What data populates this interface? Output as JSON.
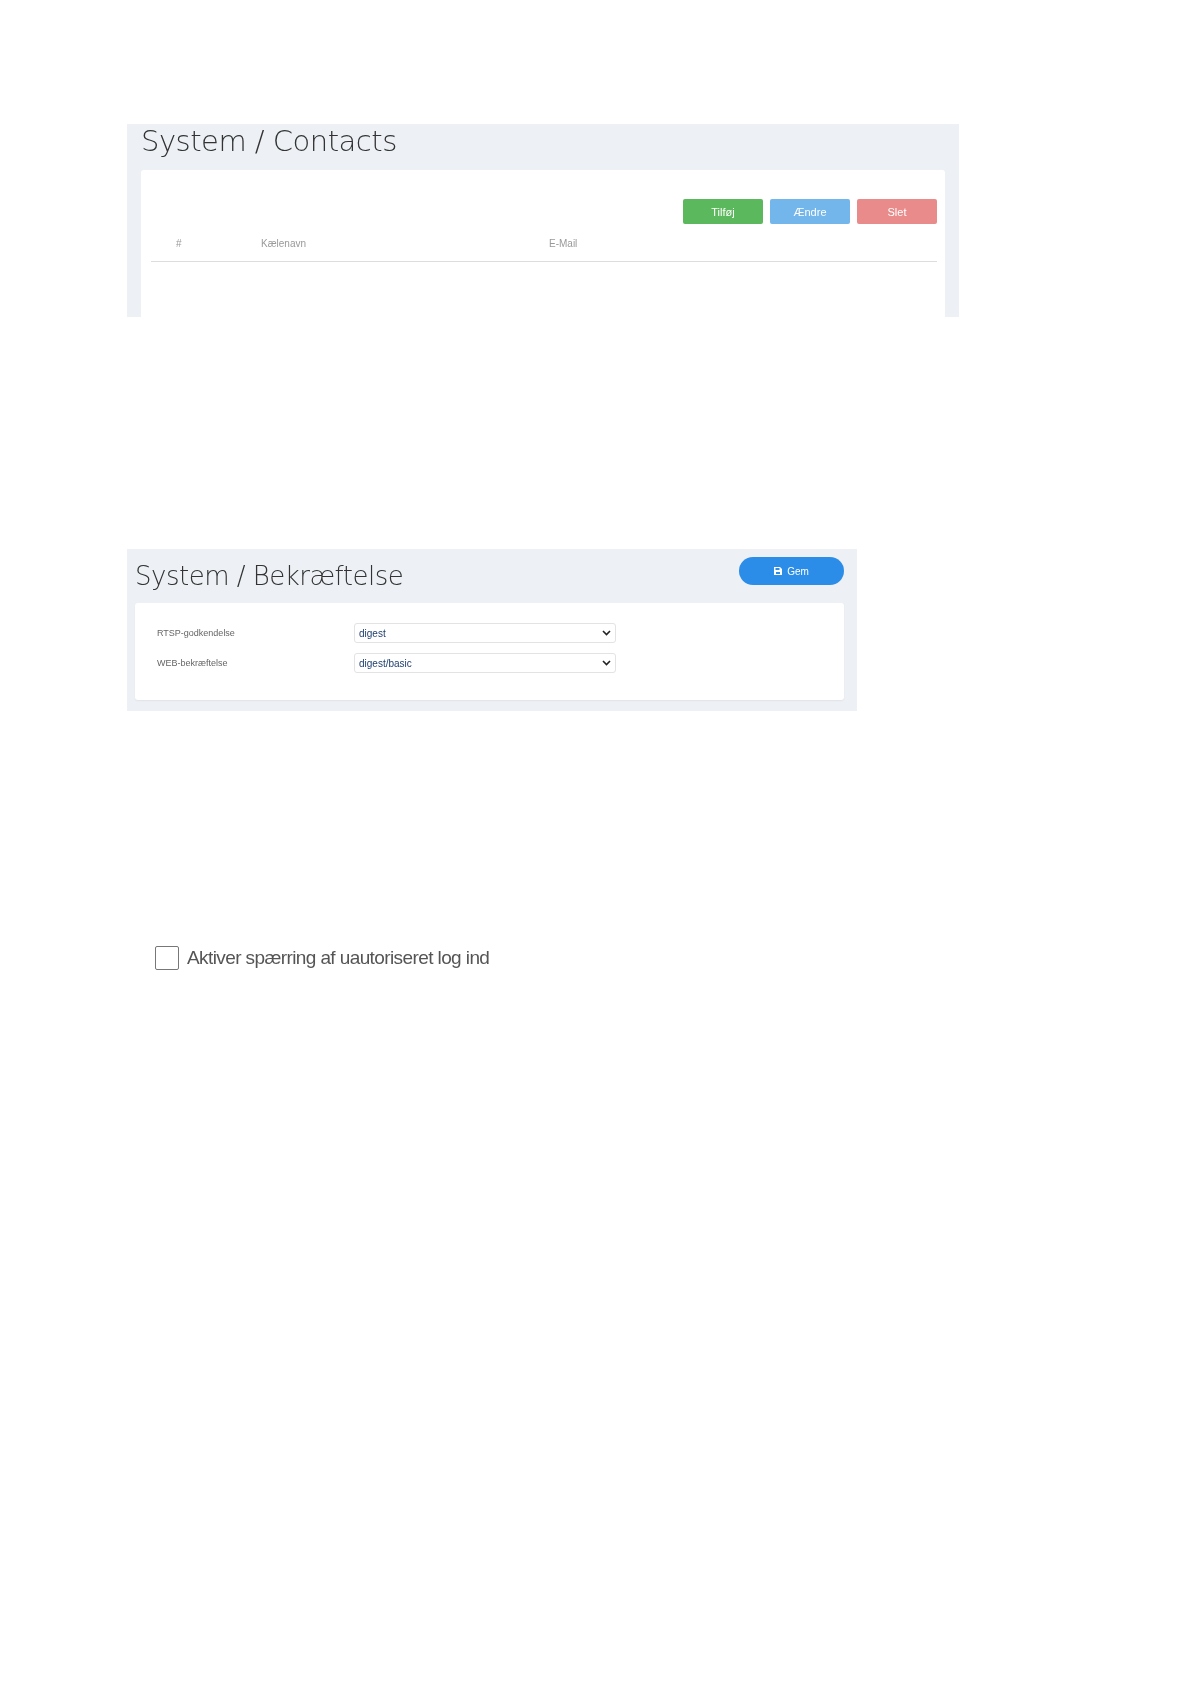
{
  "contacts_panel": {
    "title": "System / Contacts",
    "buttons": [
      {
        "label": "Tilføj",
        "kind": "add"
      },
      {
        "label": "Ændre",
        "kind": "edit"
      },
      {
        "label": "Slet",
        "kind": "delete"
      }
    ],
    "table": {
      "columns": [
        "#",
        "Kælenavn",
        "E-Mail"
      ]
    }
  },
  "authentication_panel": {
    "title": "System / Bekræftelse",
    "save_button": {
      "label": "Gem"
    },
    "fields": [
      {
        "label": "RTSP-godkendelse",
        "value": "digest"
      },
      {
        "label": "WEB-bekræftelse",
        "value": "digest/basic"
      }
    ]
  },
  "lockout_option": {
    "label": "Aktiver spærring af uautoriseret log ind",
    "checked": false
  }
}
